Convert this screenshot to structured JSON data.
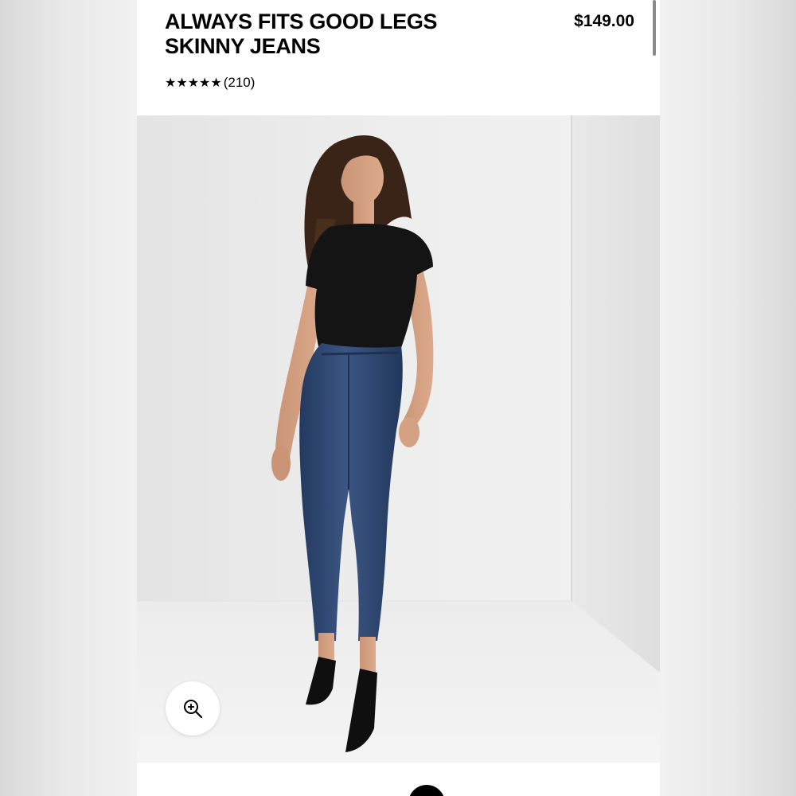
{
  "product": {
    "title": "ALWAYS FITS GOOD LEGS SKINNY JEANS",
    "price": "$149.00",
    "rating_stars": "★★★★★",
    "rating_value": 5,
    "review_count": "(210)"
  },
  "gallery": {
    "image_subject": "model-wearing-skinny-jeans",
    "zoom_icon": "zoom-in-icon"
  },
  "colors": {
    "background": "#f1f1f1",
    "text": "#000000",
    "denim": "#2e4570",
    "top": "#141414"
  }
}
